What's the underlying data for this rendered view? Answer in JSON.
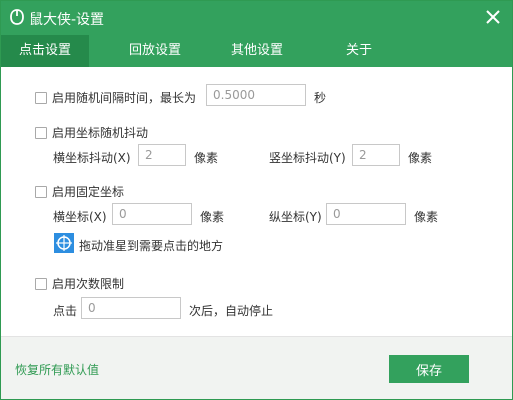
{
  "window": {
    "title": "鼠大侠-设置"
  },
  "tabs": [
    {
      "label": "点击设置",
      "active": true
    },
    {
      "label": "回放设置",
      "active": false
    },
    {
      "label": "其他设置",
      "active": false
    },
    {
      "label": "关于",
      "active": false
    }
  ],
  "settings": {
    "random_interval": {
      "label": "启用随机间隔时间，最长为",
      "value": "0.5000",
      "unit": "秒",
      "checked": false
    },
    "random_jitter": {
      "label": "启用坐标随机抖动",
      "checked": false,
      "x_label": "横坐标抖动(X)",
      "x_value": "2",
      "x_unit": "像素",
      "y_label": "竖坐标抖动(Y)",
      "y_value": "2",
      "y_unit": "像素"
    },
    "fixed_coords": {
      "label": "启用固定坐标",
      "checked": false,
      "x_label": "横坐标(X)",
      "x_value": "0",
      "x_unit": "像素",
      "y_label": "纵坐标(Y)",
      "y_value": "0",
      "y_unit": "像素",
      "drag_hint": "拖动准星到需要点击的地方"
    },
    "click_limit": {
      "label": "启用次数限制",
      "checked": false,
      "prefix": "点击",
      "value": "0",
      "suffix": "次后，自动停止"
    }
  },
  "footer": {
    "reset_label": "恢复所有默认值",
    "save_label": "保存"
  },
  "colors": {
    "brand_green": "#33a15d",
    "active_tab": "#258a4b",
    "footer_bg": "#f1f3f1"
  },
  "icons": {
    "logo": "mouse-logo-icon",
    "close": "close-icon",
    "target": "crosshair-target-icon"
  }
}
